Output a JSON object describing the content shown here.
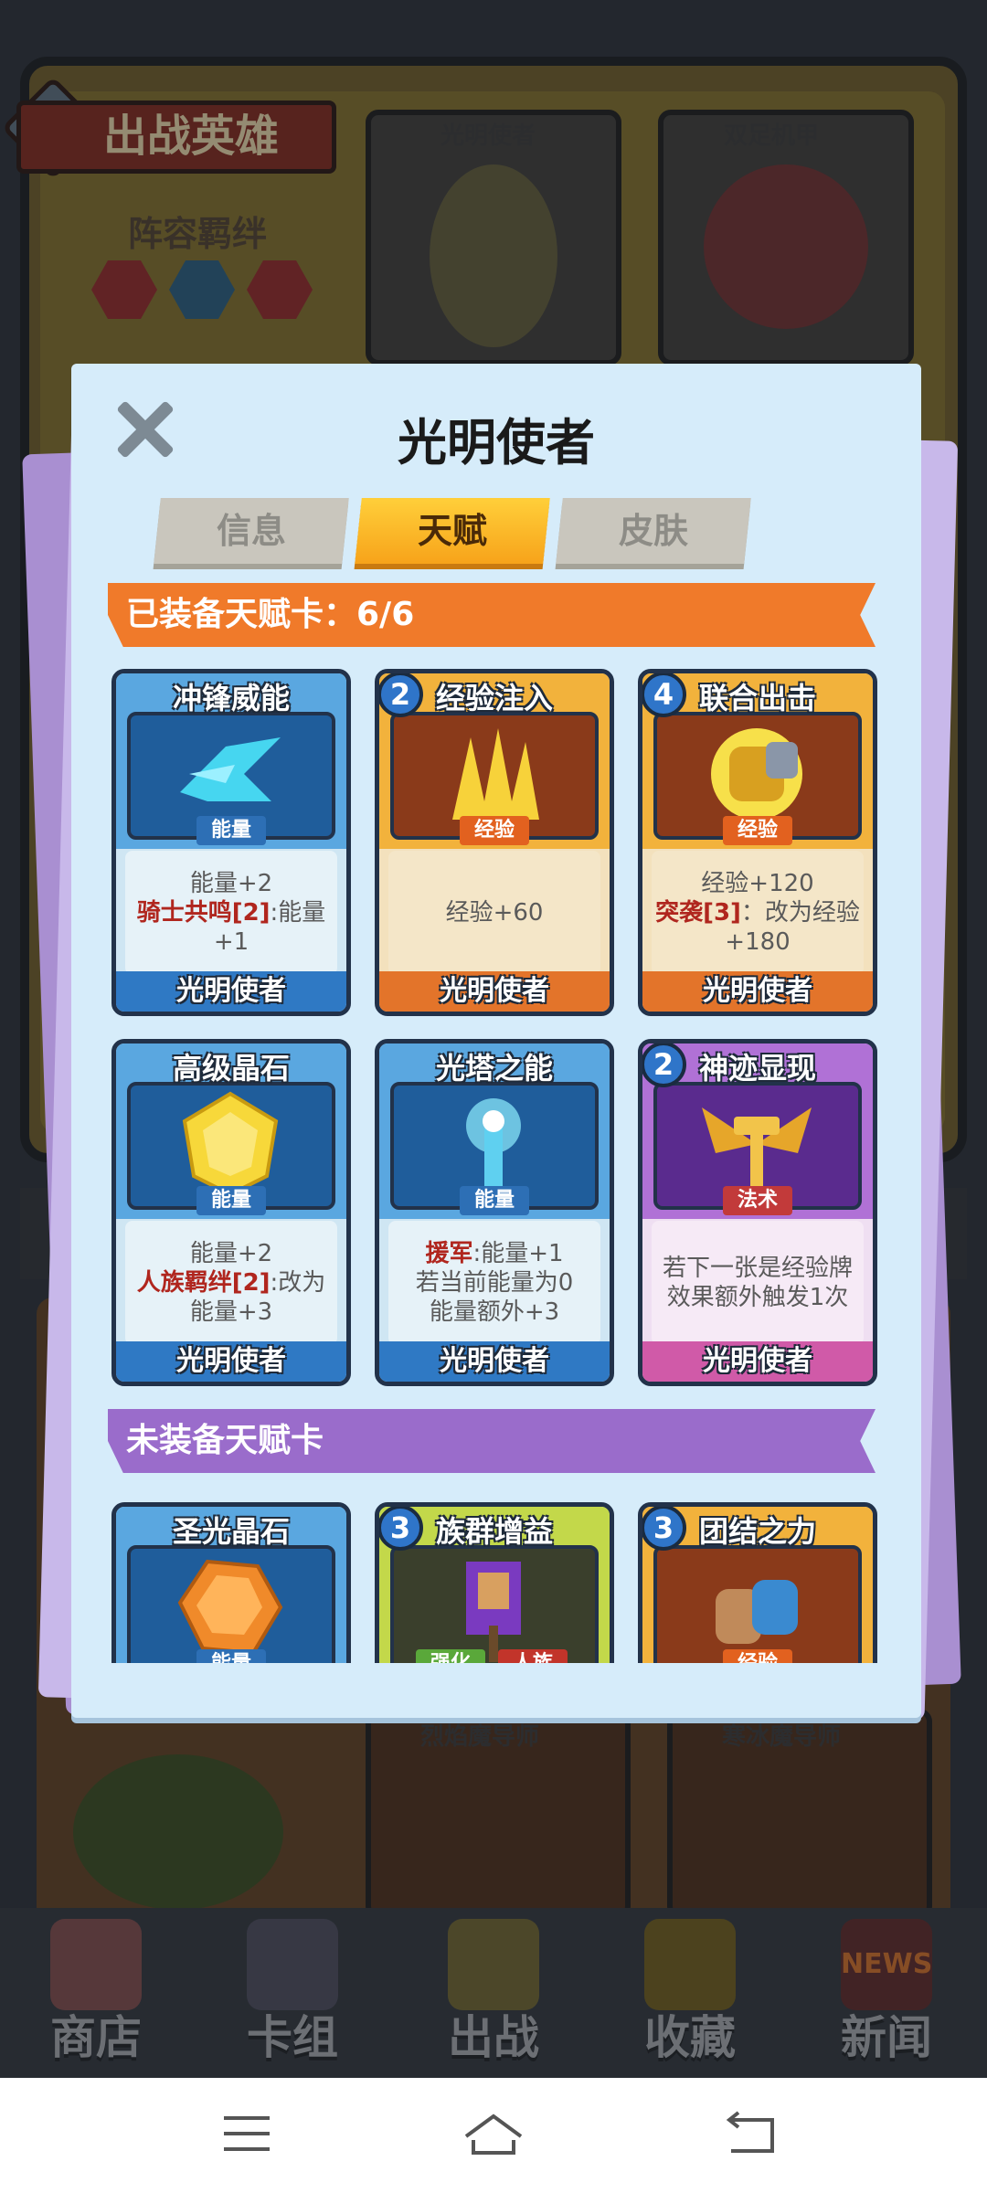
{
  "background": {
    "banner": "出战英雄",
    "lineup_label": "阵容羁绊",
    "top_heroes": [
      "光明使者",
      "双足机甲"
    ],
    "lower_heroes": [
      "烈焰魔导师",
      "寒冰魔导师"
    ]
  },
  "modal": {
    "title": "光明使者",
    "tabs": [
      {
        "label": "信息",
        "active": false
      },
      {
        "label": "天赋",
        "active": true
      },
      {
        "label": "皮肤",
        "active": false
      }
    ],
    "equipped_header": "已装备天赋卡：6/6",
    "unequipped_header": "未装备天赋卡",
    "equipped_cards": [
      {
        "name": "冲锋威能",
        "cost": "",
        "type": "能量",
        "color": "blue",
        "desc_lines": [
          "能量+2"
        ],
        "desc_rich": [
          {
            "hl": "骑士共鸣[2]",
            "rest": ":能量"
          }
        ],
        "desc_tail": "+1",
        "owner": "光明使者"
      },
      {
        "name": "经验注入",
        "cost": "2",
        "type": "经验",
        "color": "orange",
        "desc": "经验+60",
        "owner": "光明使者"
      },
      {
        "name": "联合出击",
        "cost": "4",
        "type": "经验",
        "color": "orange",
        "desc_line1": "经验+120",
        "hl": "突袭[3]",
        "rest": "：改为经验",
        "desc_tail": "+180",
        "owner": "光明使者"
      },
      {
        "name": "高级晶石",
        "cost": "",
        "type": "能量",
        "color": "blue",
        "desc_line1": "能量+2",
        "hl": "人族羁绊[2]",
        "rest": ":改为",
        "desc_tail": "能量+3",
        "owner": "光明使者"
      },
      {
        "name": "光塔之能",
        "cost": "",
        "type": "能量",
        "color": "blue",
        "hl": "援军",
        "rest": ":能量+1",
        "desc_line2": "若当前能量为0",
        "desc_tail": "能量额外+3",
        "owner": "光明使者"
      },
      {
        "name": "神迹显现",
        "cost": "2",
        "type": "法术",
        "color": "purple",
        "desc_line1": "若下一张是经验牌",
        "desc_tail": "效果额外触发1次",
        "owner": "光明使者"
      }
    ],
    "unequipped_cards": [
      {
        "name": "圣光晶石",
        "cost": "",
        "type": "能量",
        "color": "blue"
      },
      {
        "name": "族群增益",
        "cost": "3",
        "types": [
          "强化",
          "人族"
        ],
        "color": "green"
      },
      {
        "name": "团结之力",
        "cost": "3",
        "type": "经验",
        "color": "orange"
      }
    ]
  },
  "nav": [
    "商店",
    "卡组",
    "出战",
    "收藏",
    "新闻"
  ],
  "news_badge": "NEWS",
  "colors": {
    "accent_orange": "#f07a2a",
    "accent_purple": "#9a6ccb",
    "modal_bg": "#d6ecfa"
  }
}
